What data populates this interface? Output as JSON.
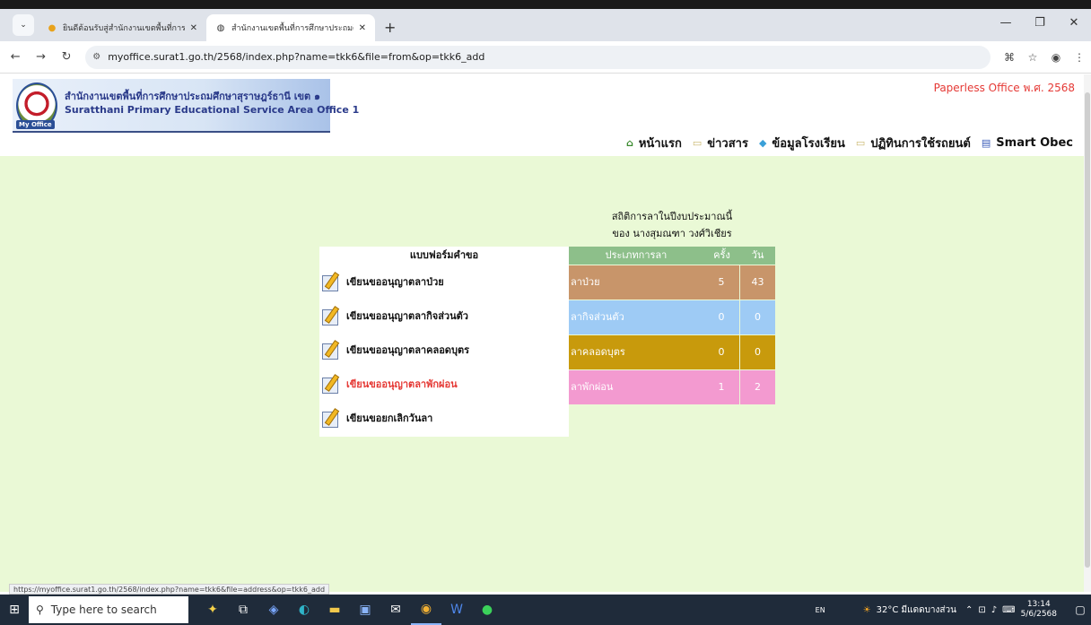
{
  "browser": {
    "tabs": [
      {
        "title": "ยินดีต้อนรับสู่สำนักงานเขตพื้นที่การศึ",
        "favicon": "flame-icon"
      },
      {
        "title": "สำนักงานเขตพื้นที่การศึกษาประถมศึ",
        "favicon": "globe-icon"
      }
    ],
    "new_tab_label": "+",
    "url": "myoffice.surat1.go.th/2568/index.php?name=tkk6&file=from&op=tkk6_add",
    "status_url": "https://myoffice.surat1.go.th/2568/index.php?name=tkk6&file=address&op=tkk6_add"
  },
  "header": {
    "logo_th": "สำนักงานเขตพื้นที่การศึกษาประถมศึกษาสุราษฎร์ธานี เขต ๑",
    "logo_en": "Suratthani Primary Educational Service Area Office 1",
    "logo_badge": "My Office",
    "paperless": "Paperless Office พ.ศ. 2568",
    "nav": [
      {
        "label": "หน้าแรก",
        "icon": "home-icon"
      },
      {
        "label": "ข่าวสาร",
        "icon": "folder-icon"
      },
      {
        "label": "ข้อมูลโรงเรียน",
        "icon": "gem-icon"
      },
      {
        "label": "ปฏิทินการใช้รถยนต์",
        "icon": "folder-icon"
      },
      {
        "label": "Smart Obec",
        "icon": "book-icon"
      }
    ]
  },
  "stats": {
    "title": "สถิติการลาในปีงบประมาณนี้",
    "subtitle": "ของ นางสุมณฑา วงศ์วิเชียร",
    "columns": [
      "ประเภทการลา",
      "ครั้ง",
      "วัน"
    ],
    "rows": [
      {
        "type": "ลาป่วย",
        "times": "5",
        "days": "43",
        "color": "#c8956a"
      },
      {
        "type": "ลากิจส่วนตัว",
        "times": "0",
        "days": "0",
        "color": "#9ecbf5"
      },
      {
        "type": "ลาคลอดบุตร",
        "times": "0",
        "days": "0",
        "color": "#c89a0c"
      },
      {
        "type": "ลาพักผ่อน",
        "times": "1",
        "days": "2",
        "color": "#f39ad0"
      }
    ]
  },
  "forms": {
    "header": "แบบฟอร์มคำขอ",
    "items": [
      {
        "label": "เขียนขออนุญาตลาป่วย",
        "highlight": false
      },
      {
        "label": "เขียนขออนุญาตลากิจส่วนตัว",
        "highlight": false
      },
      {
        "label": "เขียนขออนุญาตลาคลอดบุตร",
        "highlight": false
      },
      {
        "label": "เขียนขออนุญาตลาพักผ่อน",
        "highlight": true
      },
      {
        "label": "เขียนขอยกเลิกวันลา",
        "highlight": false
      }
    ]
  },
  "taskbar": {
    "search_placeholder": "Type here to search",
    "lang": "EN",
    "weather": "32°C มีแดดบางส่วน",
    "time": "13:14",
    "date": "5/6/2568"
  }
}
